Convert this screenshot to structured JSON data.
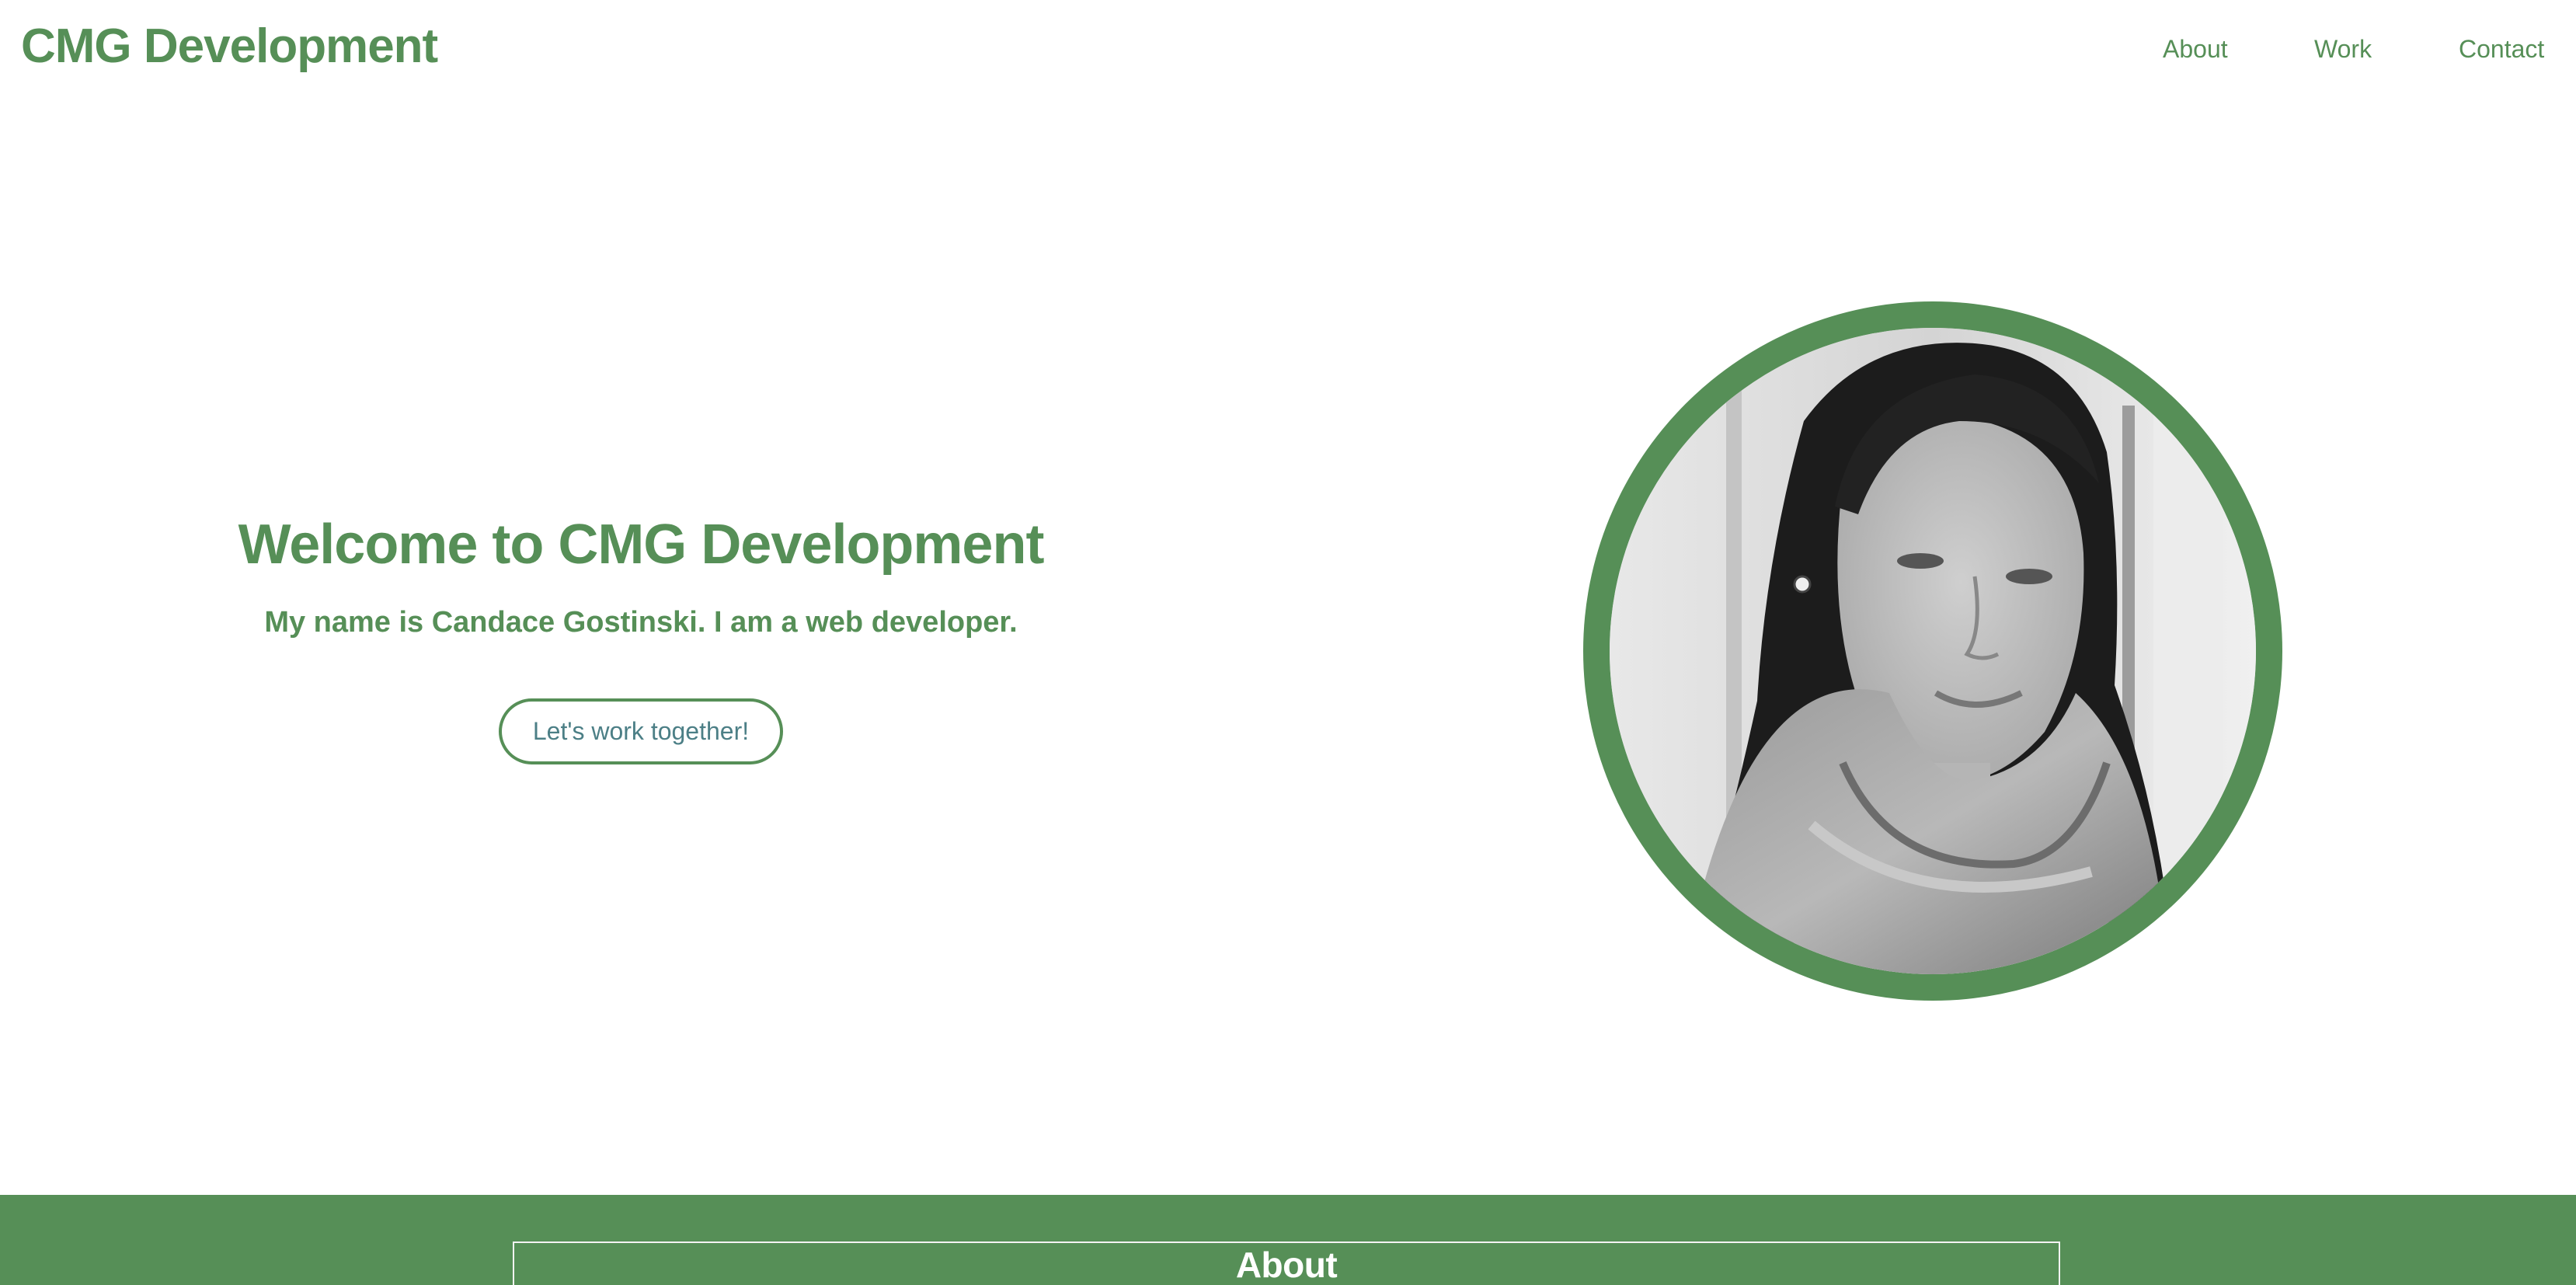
{
  "brand": {
    "name": "CMG Development"
  },
  "nav": {
    "items": [
      {
        "label": "About"
      },
      {
        "label": "Work"
      },
      {
        "label": "Contact"
      }
    ]
  },
  "hero": {
    "title": "Welcome to CMG Development",
    "subtitle": "My name is Candace Gostinski. I am a web developer.",
    "cta_label": "Let's work together!",
    "portrait_alt": "portrait"
  },
  "about": {
    "heading": "About"
  },
  "colors": {
    "accent": "#568f57",
    "button_text": "#4c7f86",
    "background": "#ffffff"
  }
}
